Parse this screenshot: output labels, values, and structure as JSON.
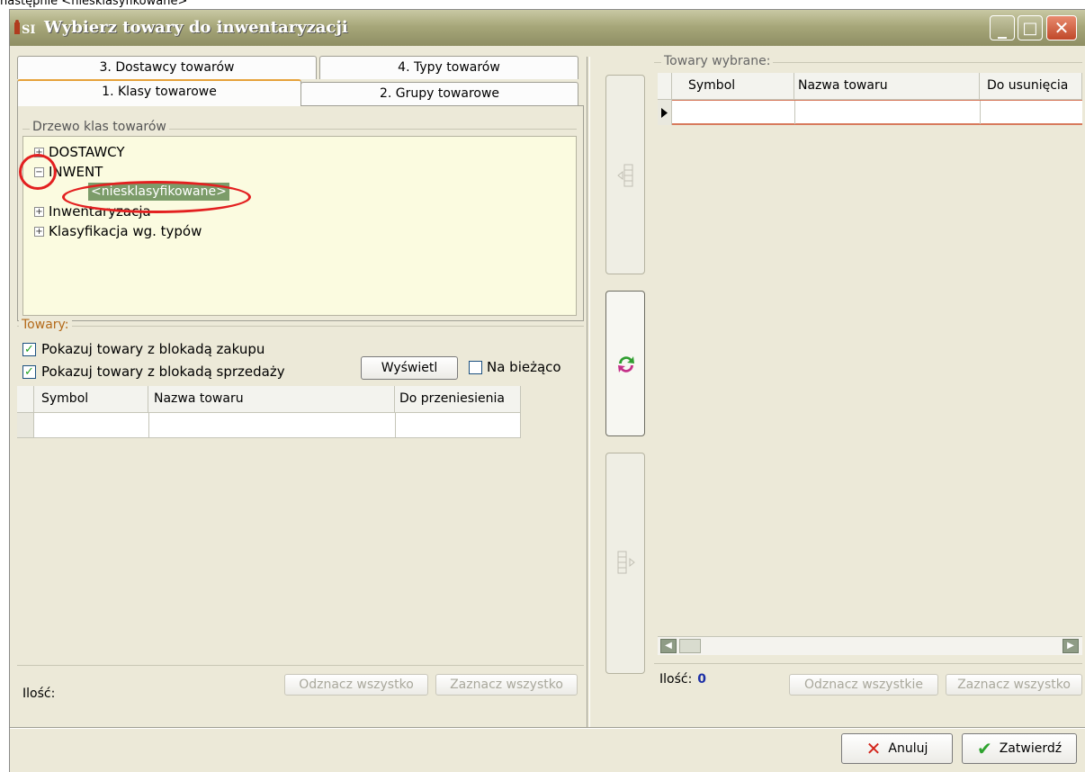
{
  "caption": "następnie <niesklasyfikowane>",
  "window": {
    "title": "Wybierz towary do inwentaryzacji",
    "controls": {
      "minimize": "_",
      "maximize": "□",
      "close": "✕"
    }
  },
  "tabs": {
    "row1": [
      "3. Dostawcy towarów",
      "4. Typy towarów"
    ],
    "row2": [
      "1. Klasy towarowe",
      "2. Grupy towarowe"
    ],
    "active": "1. Klasy towarowe"
  },
  "tree": {
    "legend": "Drzewo klas towarów",
    "items": [
      {
        "label": "DOSTAWCY",
        "expander": "+"
      },
      {
        "label": "INWENT",
        "expander": "−"
      },
      {
        "label": "<niesklasyfikowane>",
        "selected": true
      },
      {
        "label": "Inwentaryzacja",
        "expander": "+"
      },
      {
        "label": "Klasyfikacja wg. typów",
        "expander": "+"
      }
    ]
  },
  "towary": {
    "legend": "Towary:",
    "check_zakup": "Pokazuj towary z blokadą zakupu",
    "check_sprzedaz": "Pokazuj towary z blokadą sprzedaży",
    "show_button": "Wyświetl",
    "na_biezaco": "Na bieżąco",
    "columns": [
      "Symbol",
      "Nazwa towaru",
      "Do przeniesienia"
    ],
    "ilosc_label": "Ilość:",
    "odznacz": "Odznacz wszystko",
    "zaznacz": "Zaznacz wszystko"
  },
  "selected": {
    "legend": "Towary wybrane:",
    "columns": [
      "Symbol",
      "Nazwa towaru",
      "Do usunięcia"
    ],
    "ilosc_label": "Ilość:",
    "ilosc_value": "0",
    "odznacz": "Odznacz wszystkie",
    "zaznacz": "Zaznacz wszystko"
  },
  "footer": {
    "cancel": "Anuluj",
    "confirm": "Zatwierdź"
  },
  "colors": {
    "title_bar": "#a7a77a",
    "tree_bg": "#fbfbe0",
    "highlight": "#e32020",
    "selected_item": "#7c9c6a"
  }
}
